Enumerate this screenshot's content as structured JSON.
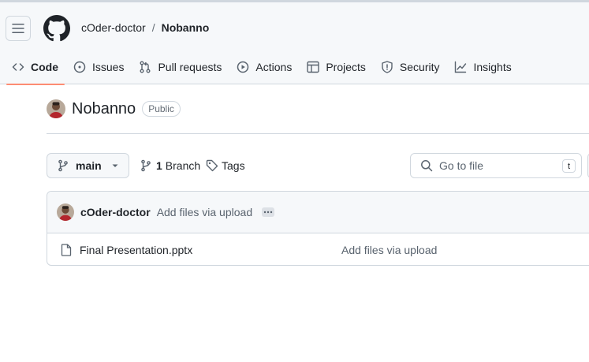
{
  "header": {
    "owner": "cOder-doctor",
    "separator": "/",
    "repo": "Nobanno"
  },
  "tabs": [
    {
      "label": "Code",
      "icon": "code-icon",
      "active": true
    },
    {
      "label": "Issues",
      "icon": "issue-opened-icon"
    },
    {
      "label": "Pull requests",
      "icon": "git-pull-request-icon"
    },
    {
      "label": "Actions",
      "icon": "play-icon"
    },
    {
      "label": "Projects",
      "icon": "table-icon"
    },
    {
      "label": "Security",
      "icon": "shield-icon"
    },
    {
      "label": "Insights",
      "icon": "graph-icon"
    }
  ],
  "repo": {
    "name": "Nobanno",
    "visibility": "Public"
  },
  "toolbar": {
    "branch": "main",
    "branch_count": "1",
    "branch_word": "Branch",
    "tags_label": "Tags",
    "goto_placeholder": "Go to file",
    "goto_shortcut": "t"
  },
  "latest_commit": {
    "author": "cOder-doctor",
    "message": "Add files via upload"
  },
  "files": [
    {
      "name": "Final Presentation.pptx",
      "commit": "Add files via upload",
      "icon": "file-icon"
    }
  ],
  "colors": {
    "accent_underline": "#fd8c73",
    "border": "#d0d7de",
    "muted_text": "#59636e"
  }
}
